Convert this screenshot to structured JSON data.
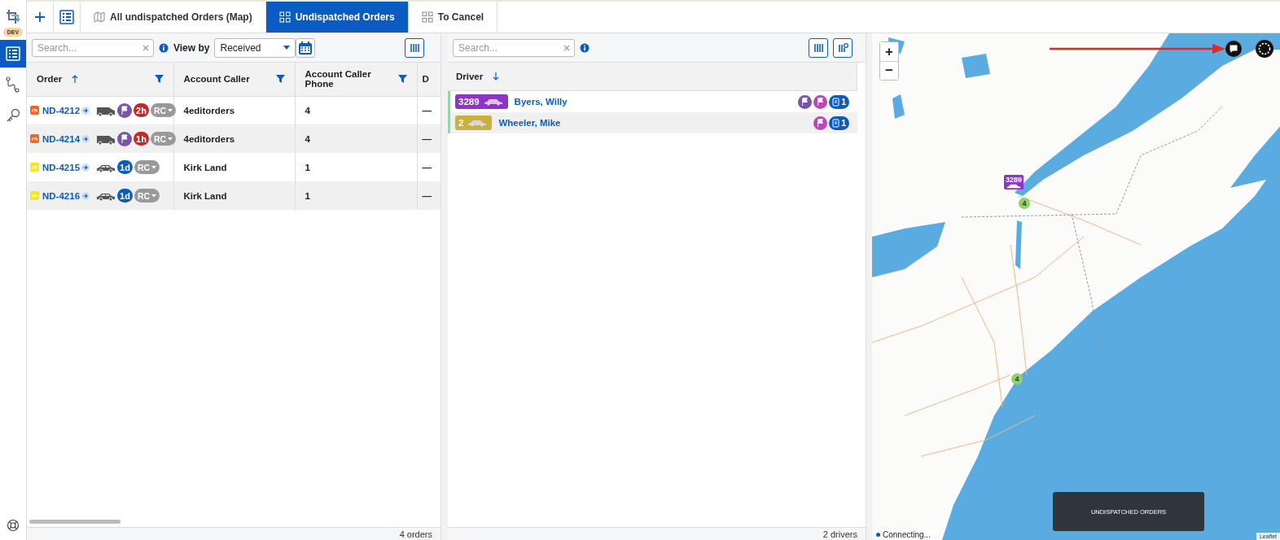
{
  "sidebar": {
    "badge": "DEV",
    "items": [
      {
        "kind": "list",
        "selected": true
      },
      {
        "kind": "route",
        "selected": false
      },
      {
        "kind": "key",
        "selected": false
      }
    ]
  },
  "toolbar": {
    "buttons": [
      {
        "kind": "add"
      },
      {
        "kind": "list"
      }
    ]
  },
  "tabs": [
    {
      "label": "All undispatched Orders (Map)",
      "kind": "map",
      "selected": false
    },
    {
      "label": "Undispatched Orders",
      "kind": "grid",
      "selected": true
    },
    {
      "label": "To Cancel",
      "kind": "grid",
      "selected": false
    }
  ],
  "orders": {
    "search": {
      "placeholder": "Search..."
    },
    "view_by": {
      "label": "View by",
      "value": "Received"
    },
    "columns": [
      {
        "label": "Order",
        "sort": {
          "kind": "ascending"
        },
        "filter": true
      },
      {
        "label": "Account Caller",
        "filter": true
      },
      {
        "label": "Account Caller Phone",
        "filter": true
      },
      {
        "label": "D",
        "filter": false
      }
    ],
    "rows": [
      {
        "order": "ND-4212",
        "source": {
          "color": "#f26522"
        },
        "vehicle": {
          "kind": "van"
        },
        "flag": true,
        "age": {
          "text": "2h",
          "color": "#c62828"
        },
        "tag": "RC",
        "caller": "4editorders",
        "phone": "4",
        "column_4": "—"
      },
      {
        "order": "ND-4214",
        "source": {
          "color": "#f26522"
        },
        "vehicle": {
          "kind": "van"
        },
        "flag": true,
        "age": {
          "text": "1h",
          "color": "#c62828"
        },
        "tag": "RC",
        "caller": "4editorders",
        "phone": "4",
        "column_4": "—"
      },
      {
        "order": "ND-4215",
        "source": {
          "color": "#f5e61e"
        },
        "vehicle": {
          "kind": "car"
        },
        "flag": false,
        "age": {
          "text": "1d",
          "color": "#0a5cc2"
        },
        "tag": "RC",
        "caller": "Kirk Land",
        "phone": "1",
        "column_4": "—"
      },
      {
        "order": "ND-4216",
        "source": {
          "color": "#f5e61e"
        },
        "vehicle": {
          "kind": "car"
        },
        "flag": false,
        "age": {
          "text": "1d",
          "color": "#0a5cc2"
        },
        "tag": "RC",
        "caller": "Kirk Land",
        "phone": "1",
        "column_4": "—"
      }
    ],
    "footer": "4 orders"
  },
  "drivers": {
    "search": {
      "placeholder": "Search..."
    },
    "columns": [
      {
        "label": "Driver",
        "sort": {
          "kind": "descending"
        }
      }
    ],
    "rows": [
      {
        "number": "3289",
        "color": "#8e35c7",
        "name": "Byers, Willy",
        "flags": [
          {
            "color": "#7756aa"
          },
          {
            "color": "#c043b8"
          }
        ],
        "count": "1"
      },
      {
        "number": "2",
        "color": "#c9b13c",
        "name": "Wheeler, Mike",
        "flags": [
          {
            "color": "#c043b8"
          }
        ],
        "count": "1"
      }
    ],
    "footer": "2 drivers"
  },
  "map": {
    "zoom_in": "+",
    "zoom_out": "−",
    "markers": [
      {
        "kind": "vehicle",
        "label": "3289",
        "color": "#8e35c7"
      },
      {
        "kind": "cluster",
        "label": "4",
        "color": "#8fd46a"
      },
      {
        "kind": "cluster",
        "label": "4",
        "color": "#8fd46a"
      }
    ],
    "toast": "UNDISPATCHED ORDERS",
    "status": "Connecting...",
    "attribution": "Leaflet"
  }
}
